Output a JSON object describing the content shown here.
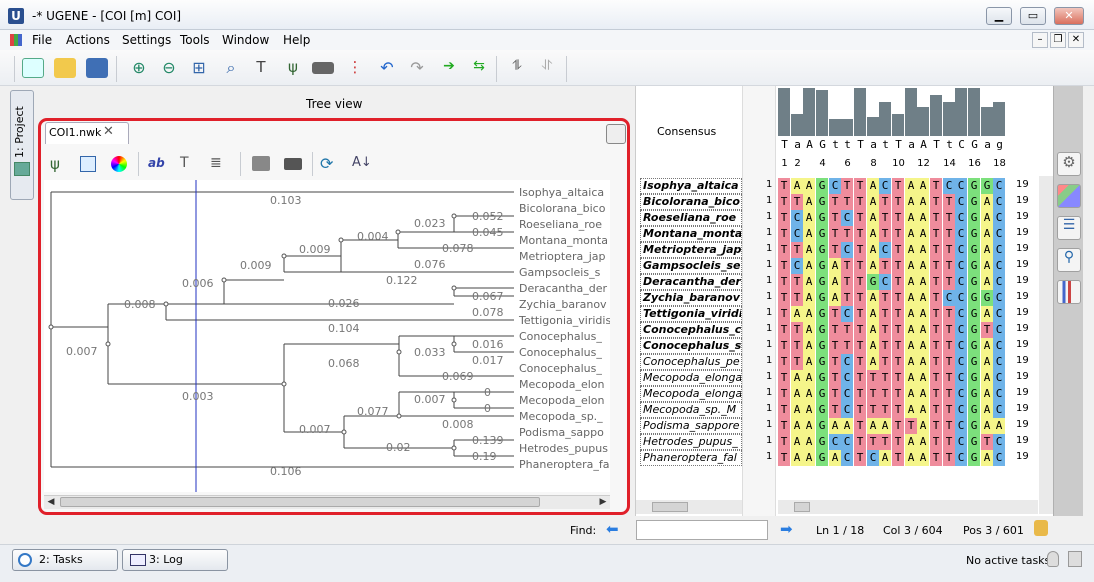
{
  "window": {
    "title": "-* UGENE - [COI [m] COI]",
    "app_icon_letter": "U"
  },
  "menu": [
    "File",
    "Actions",
    "Settings",
    "Tools",
    "Window",
    "Help"
  ],
  "project_tab": {
    "number": "1",
    "label": "Project"
  },
  "tree_view": {
    "heading": "Tree view",
    "tab_label": "COI1.nwk",
    "leaves": [
      "Isophya_altaica",
      "Bicolorana_bico",
      "Roeseliana_roe",
      "Montana_monta",
      "Metrioptera_jap",
      "Gampsocleis_s",
      "Deracantha_der",
      "Zychia_baranov",
      "Tettigonia_viridis",
      "Conocephalus_",
      "Conocephalus_",
      "Conocephalus_",
      "Mecopoda_elon",
      "Mecopoda_elon",
      "Mecopoda_sp._",
      "Podisma_sappo",
      "Hetrodes_pupus",
      "Phaneroptera_fa"
    ],
    "branch_labels": [
      "0.103",
      "0.052",
      "0.023",
      "0.045",
      "0.004",
      "0.078",
      "0.009",
      "0.009",
      "0.076",
      "0.122",
      "0.006",
      "0.067",
      "0.008",
      "0.026",
      "0.078",
      "0.104",
      "0.016",
      "0.007",
      "0.033",
      "0.017",
      "0.068",
      "0.069",
      "0.003",
      "0",
      "0.007",
      "0",
      "0.077",
      "0.008",
      "0.007",
      "0.139",
      "0.02",
      "0.19",
      "0.106"
    ]
  },
  "alignment": {
    "consensus_label": "Consensus",
    "consensus_seq": "TaAGttTatTaATtCGag",
    "consensus_heights": [
      1,
      0.45,
      1,
      0.95,
      0.35,
      0.35,
      1,
      0.4,
      0.7,
      0.45,
      1,
      0.6,
      0.85,
      0.7,
      1,
      1,
      0.6,
      0.7
    ],
    "ruler": [
      "1",
      "2",
      "4",
      "6",
      "8",
      "10",
      "12",
      "14",
      "16",
      "18"
    ],
    "sequences": [
      {
        "name": "Isophya_altaica",
        "bold": true,
        "seq": "TAAGCTTACTAATCCGGC"
      },
      {
        "name": "Bicolorana_bico",
        "bold": true,
        "seq": "TTAGTTTATTAATTCGAC"
      },
      {
        "name": "Roeseliana_roe",
        "bold": true,
        "seq": "TCAGTCTATTAATTCGAC"
      },
      {
        "name": "Montana_monta",
        "bold": true,
        "seq": "TCAGTTTATTAATTCGAC"
      },
      {
        "name": "Metrioptera_jap",
        "bold": true,
        "seq": "TTAGTCTACTAATTCGAC"
      },
      {
        "name": "Gampsocleis_se",
        "bold": true,
        "seq": "TCAGATTATTAATTCGAC"
      },
      {
        "name": "Deracantha_der",
        "bold": true,
        "seq": "TTAGATTGCTAATTCGAC"
      },
      {
        "name": "Zychia_baranov",
        "bold": true,
        "seq": "TTAGATTATTAATCCGGC"
      },
      {
        "name": "Tettigonia_viridis",
        "bold": true,
        "seq": "TAAGTCTATTAATTCGAC"
      },
      {
        "name": "Conocephalus_c",
        "bold": true,
        "seq": "TTAGTTTATTAATTCGTC"
      },
      {
        "name": "Conocephalus_s",
        "bold": true,
        "seq": "TTAGTTTATTAATTCGAC"
      },
      {
        "name": "Conocephalus_pe",
        "bold": false,
        "seq": "TTAGTCTATTAATTCGAC"
      },
      {
        "name": "Mecopoda_elonga",
        "bold": false,
        "seq": "TAAGTCTTTTAATTCGAC"
      },
      {
        "name": "Mecopoda_elonga",
        "bold": false,
        "seq": "TAAGTCTTTTAATTCGAC"
      },
      {
        "name": "Mecopoda_sp._M",
        "bold": false,
        "seq": "TAAGTCTTTTAATTCGAC"
      },
      {
        "name": "Podisma_sappore",
        "bold": false,
        "seq": "TAAGAATAATTATTCGAA"
      },
      {
        "name": "Hetrodes_pupus_",
        "bold": false,
        "seq": "TAAGCCTTTTAATTCGTC"
      },
      {
        "name": "Phaneroptera_fal",
        "bold": false,
        "seq": "TAAGACTCATAATTCGAC"
      }
    ],
    "left_index": "1",
    "right_index": "19",
    "base_colors": {
      "A": "#f5f58a",
      "T": "#ef8c9c",
      "C": "#6fb3e8",
      "G": "#7ce07c"
    }
  },
  "status": {
    "find_label": "Find:",
    "line": "Ln 1 / 18",
    "col": "Col 3 / 604",
    "pos": "Pos 3 / 601"
  },
  "bottom": {
    "tasks_label": "2: Tasks",
    "log_label": "3: Log",
    "active_tasks": "No active tasks"
  }
}
